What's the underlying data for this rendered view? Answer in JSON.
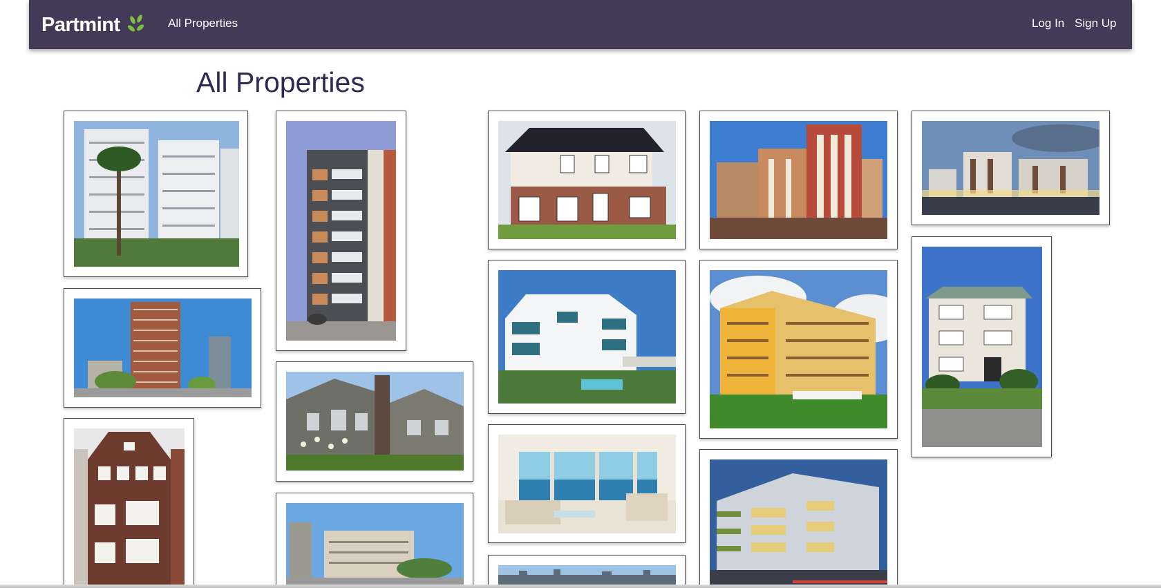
{
  "navbar": {
    "brand": "Partmint",
    "all_properties_link": "All Properties",
    "login": "Log In",
    "signup": "Sign Up",
    "background": "#433a57",
    "leaf_color": "#7bc043"
  },
  "page": {
    "title": "All Properties",
    "title_color": "#2e2a52"
  },
  "properties": [
    {
      "name": "property-white-highrise-palm"
    },
    {
      "name": "property-gray-slim-tower"
    },
    {
      "name": "property-two-story-house"
    },
    {
      "name": "property-red-brick-apartments"
    },
    {
      "name": "property-modern-complex-dusk"
    },
    {
      "name": "property-brick-tower-skyline"
    },
    {
      "name": "property-white-seaside-villa"
    },
    {
      "name": "property-yellow-apartments"
    },
    {
      "name": "property-three-story-house"
    },
    {
      "name": "property-brick-townhouse"
    },
    {
      "name": "property-gray-townhomes"
    },
    {
      "name": "property-ocean-view-interior"
    },
    {
      "name": "property-glass-corner-building"
    },
    {
      "name": "property-office-block-street"
    },
    {
      "name": "property-city-skyline"
    }
  ]
}
